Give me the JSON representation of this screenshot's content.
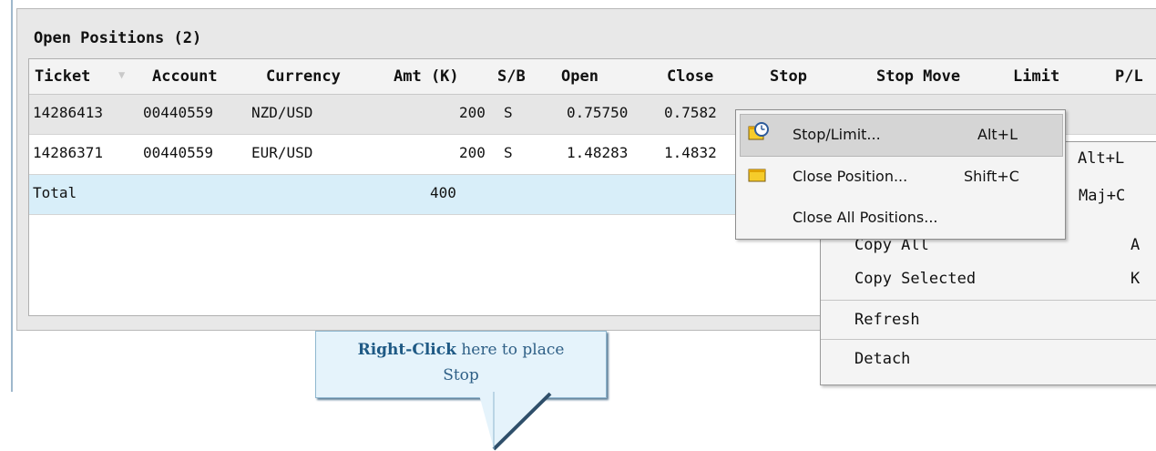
{
  "panel": {
    "title": "Open Positions (2)"
  },
  "table": {
    "columns": [
      "Ticket",
      "Account",
      "Currency",
      "Amt (K)",
      "S/B",
      "Open",
      "Close",
      "Stop",
      "Stop Move",
      "Limit",
      "P/L"
    ],
    "rows": [
      {
        "ticket": "14286413",
        "account": "00440559",
        "currency": "NZD/USD",
        "amt": "200",
        "sb": "S",
        "open": "0.75750",
        "close": "0.7582"
      },
      {
        "ticket": "14286371",
        "account": "00440559",
        "currency": "EUR/USD",
        "amt": "200",
        "sb": "S",
        "open": "1.48283",
        "close": "1.4832"
      }
    ],
    "total": {
      "label": "Total",
      "amt": "400"
    }
  },
  "context_menu_main": {
    "shortcuts": {
      "row1": "Alt+L",
      "row2": "Maj+C"
    },
    "items": [
      {
        "label": "Copy All",
        "key": "A"
      },
      {
        "label": "Copy Selected",
        "key": "K"
      },
      {
        "label": "Refresh",
        "key": ""
      },
      {
        "label": "Detach",
        "key": ""
      }
    ]
  },
  "context_menu_popup": {
    "items": [
      {
        "label": "Stop/Limit...",
        "key": "Alt+L",
        "icon": "stop-limit-icon"
      },
      {
        "label": "Close Position...",
        "key": "Shift+C",
        "icon": "close-position-icon"
      },
      {
        "label": "Close All Positions...",
        "key": ""
      }
    ]
  },
  "callout": {
    "bold": "Right-Click",
    "text": "here to place",
    "line2": "Stop"
  },
  "colors": {
    "total_row": "#d8eef9",
    "callout_bg": "#e5f3fb",
    "callout_text": "#2e5f86",
    "icon_yellow": "#f6cc2a"
  }
}
